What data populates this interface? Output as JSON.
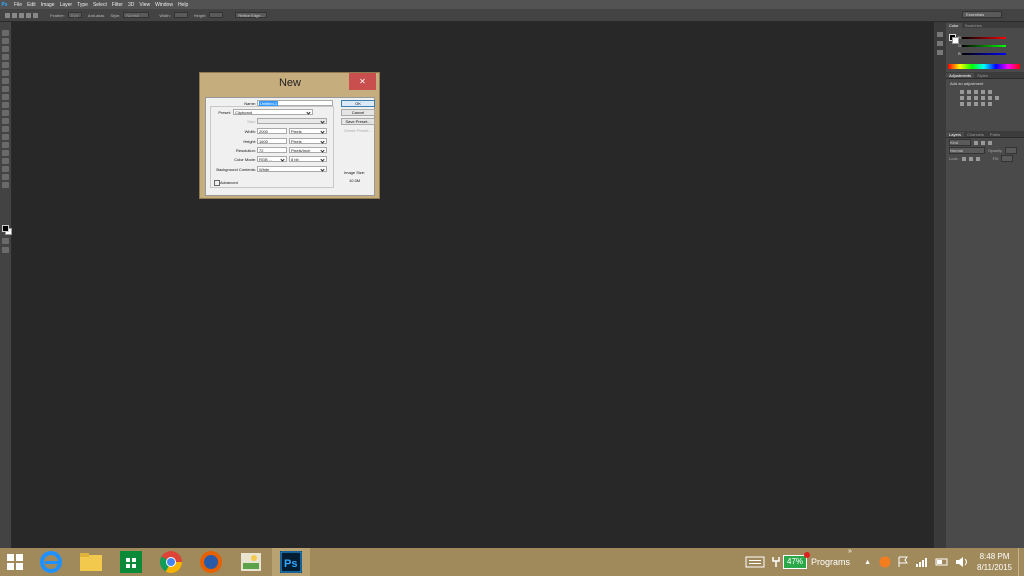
{
  "menubar": {
    "app_icon": "Ps",
    "items": [
      "File",
      "Edit",
      "Image",
      "Layer",
      "Type",
      "Select",
      "Filter",
      "3D",
      "View",
      "Window",
      "Help"
    ]
  },
  "options_bar": {
    "feather_label": "Feather:",
    "feather_value": "0 px",
    "antialias_label": "Anti-alias",
    "style_label": "Style:",
    "style_value": "Normal",
    "width_label": "Width:",
    "height_label": "Height:",
    "refine_edge": "Refine Edge...",
    "workspace": "Essentials"
  },
  "panels": {
    "color_tabs": [
      "Color",
      "Swatches"
    ],
    "color_labels": [
      "R",
      "G",
      "B"
    ],
    "adjust_tabs": [
      "Adjustments",
      "Styles"
    ],
    "adjust_title": "Add an adjustment",
    "layers_tabs": [
      "Layers",
      "Channels",
      "Paths"
    ],
    "kind_label": "Kind",
    "blend_mode": "Normal",
    "opacity_label": "Opacity:",
    "lock_label": "Lock:",
    "fill_label": "Fill:"
  },
  "dialog": {
    "title": "New",
    "close": "✕",
    "name_label": "Name:",
    "name_value": "Untitled-1",
    "preset_label": "Preset:",
    "preset_value": "Clipboard",
    "size_label": "Size:",
    "width_label": "Width:",
    "width_value": "2000",
    "width_unit": "Pixels",
    "height_label": "Height:",
    "height_value": "1600",
    "height_unit": "Pixels",
    "resolution_label": "Resolution:",
    "resolution_value": "72",
    "resolution_unit": "Pixels/Inch",
    "color_mode_label": "Color Mode:",
    "color_mode_value": "RGB ...",
    "bit_depth": "8 bit",
    "bg_label": "Background Contents:",
    "bg_value": "White",
    "advanced": "Advanced",
    "ok": "OK",
    "cancel": "Cancel",
    "save_preset": "Save Preset...",
    "delete_preset": "Delete Preset...",
    "image_size_label": "Image Size:",
    "image_size_value": "10.3M"
  },
  "taskbar": {
    "apps": [
      "Internet Explorer",
      "File Explorer",
      "Store",
      "Chrome",
      "Firefox",
      "Photos",
      "Photoshop"
    ],
    "battery": "47%",
    "programs": "Programs",
    "time": "8:48 PM",
    "date": "8/11/2015"
  },
  "colors": {
    "canvas": "#282828",
    "taskbar": "#a08a5c",
    "dialog_frame": "#c6ad7e",
    "close_red": "#c94f4f",
    "ps_blue": "#31a8ff"
  }
}
